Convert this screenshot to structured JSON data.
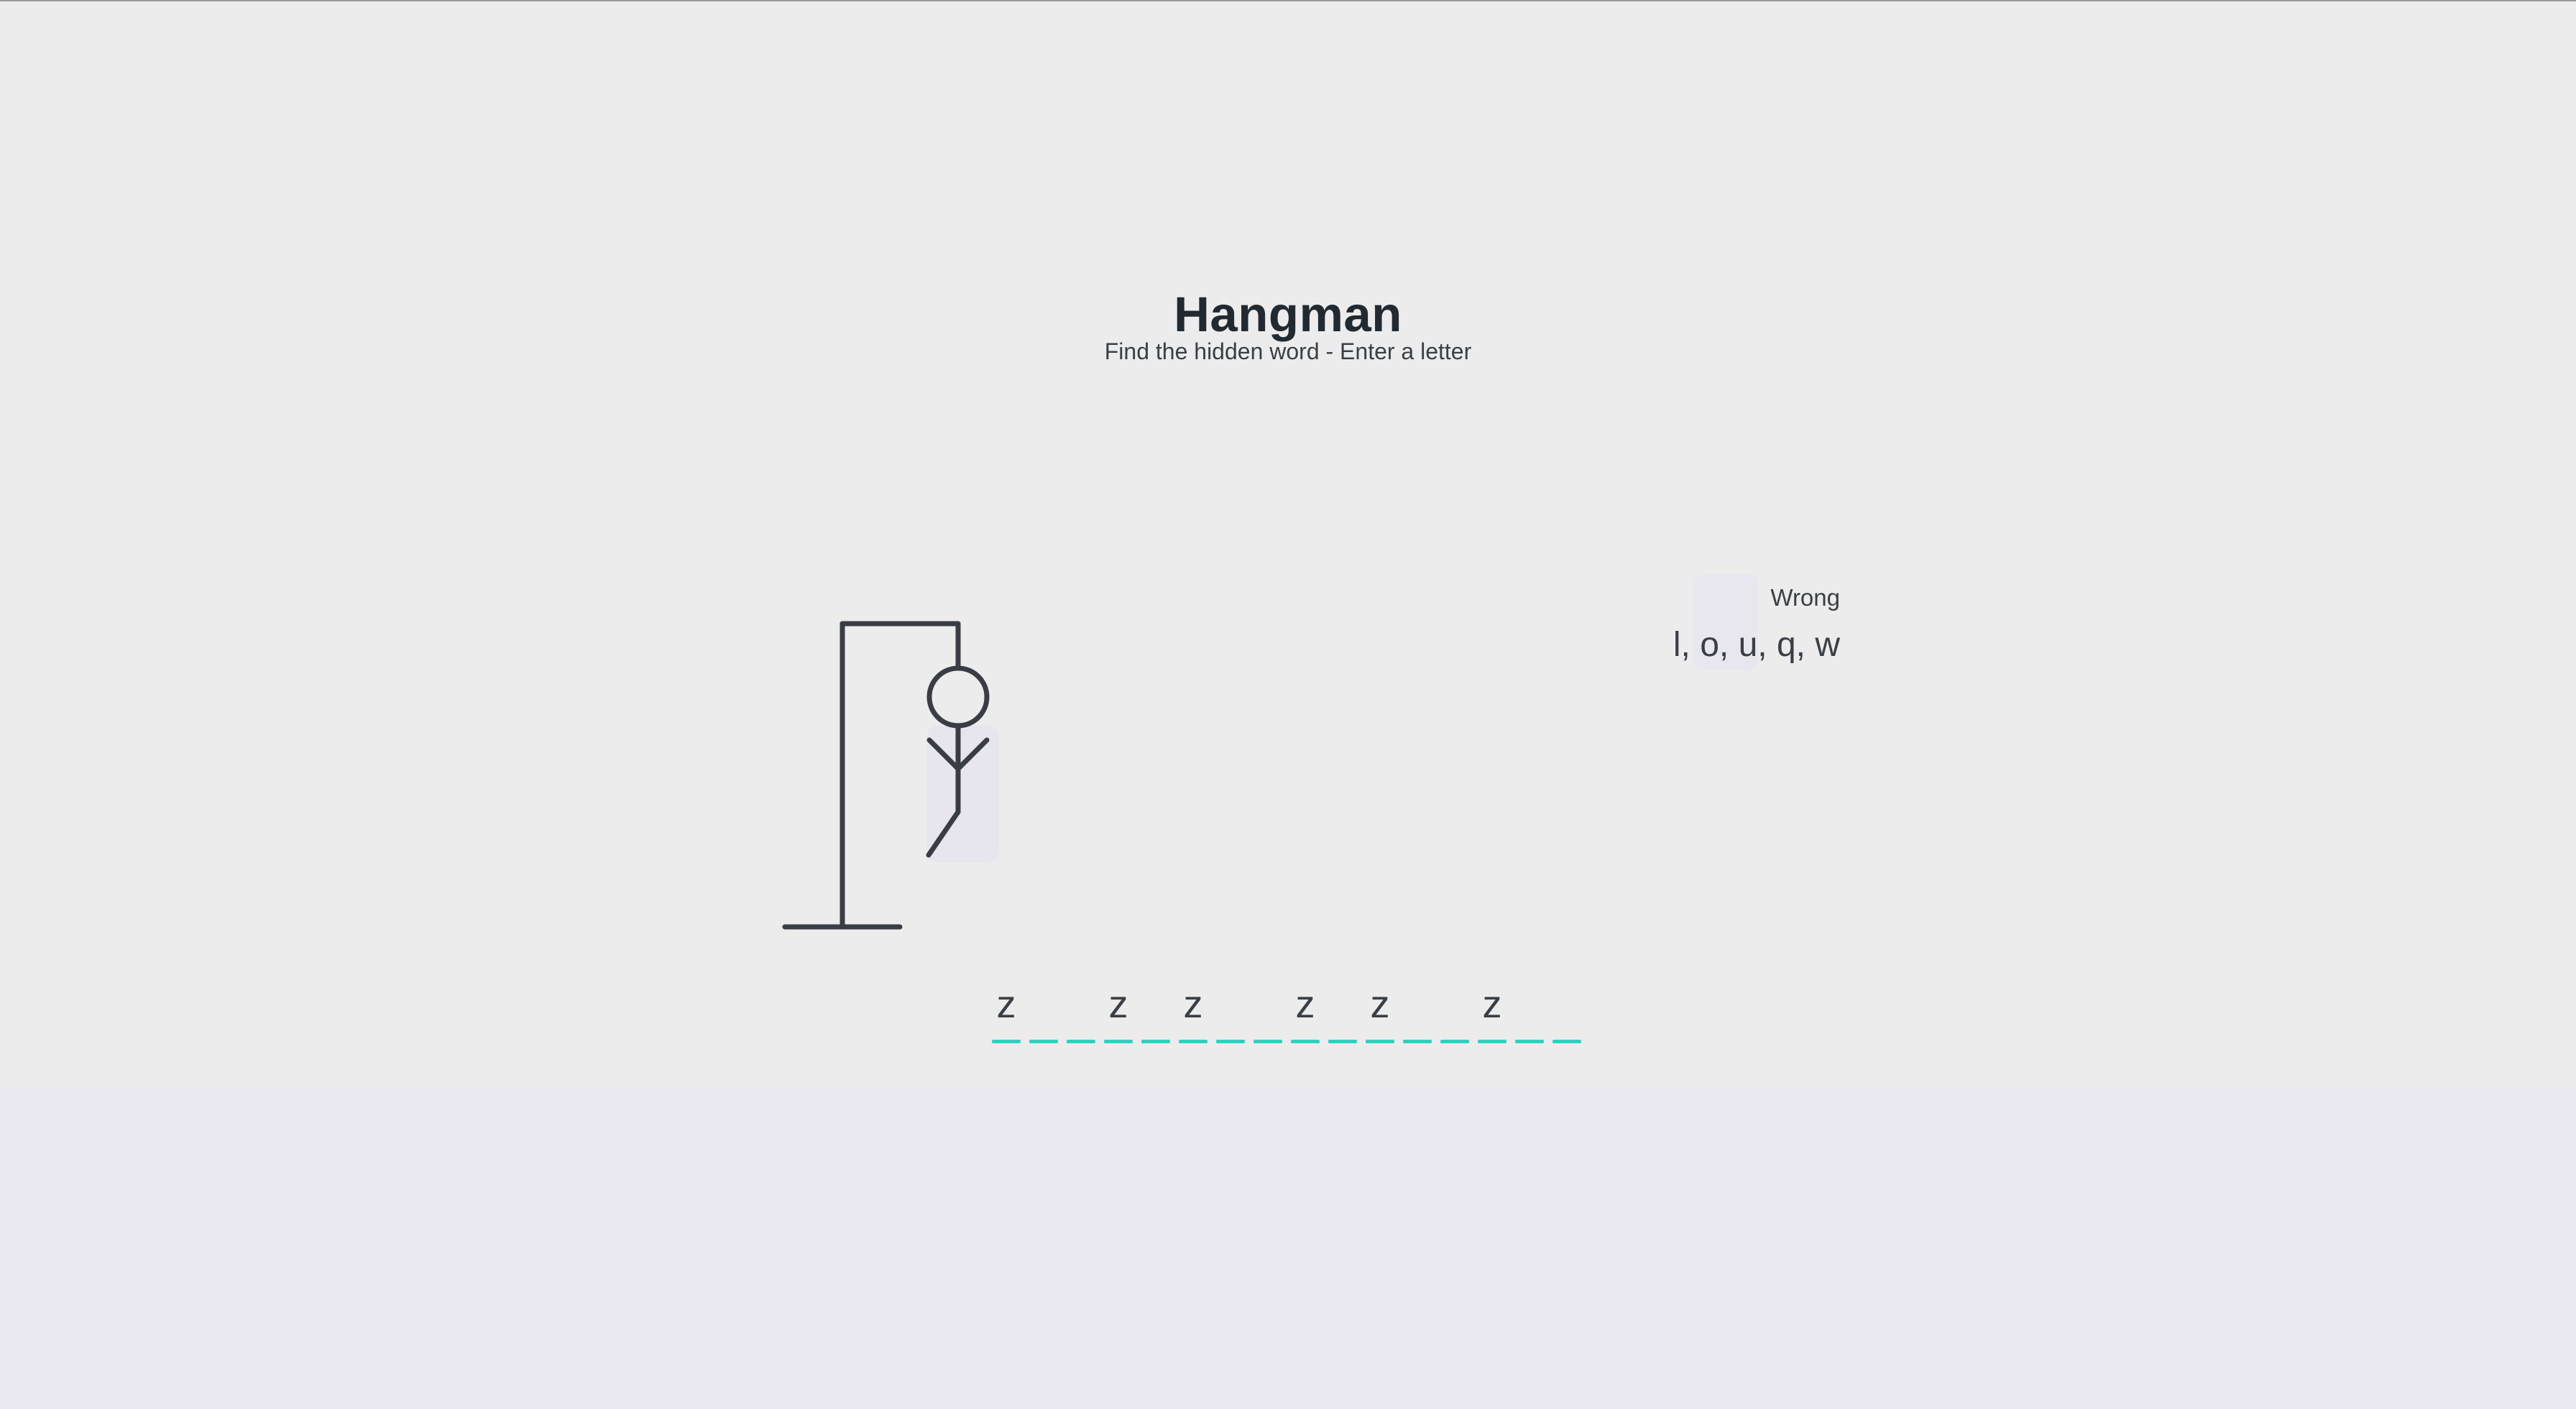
{
  "header": {
    "title": "Hangman",
    "subtitle": "Find the hidden word - Enter a letter"
  },
  "wrong": {
    "label": "Wrong",
    "letters": "l, o, u, q, w"
  },
  "word": {
    "slots": [
      "z",
      "",
      "",
      "z",
      "",
      "z",
      "",
      "",
      "z",
      "",
      "z",
      "",
      "",
      "z",
      "",
      ""
    ]
  },
  "colors": {
    "dash": "#2fd0be",
    "text": "#3a3f45",
    "title": "#222a31",
    "game_bg": "#ececec",
    "page_bg": "#eae9f1"
  }
}
